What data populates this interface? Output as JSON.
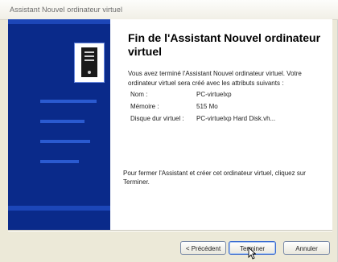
{
  "window": {
    "title": "Assistant Nouvel ordinateur virtuel"
  },
  "main": {
    "heading": "Fin de l'Assistant Nouvel ordinateur virtuel",
    "intro": "Vous avez terminé l'Assistant Nouvel ordinateur virtuel. Votre ordinateur virtuel sera créé avec les attributs suivants :",
    "attributes": [
      {
        "key": "Nom :",
        "value": "PC-virtuelxp"
      },
      {
        "key": "Mémoire :",
        "value": "515 Mo"
      },
      {
        "key": "Disque dur virtuel :",
        "value": "PC-virtuelxp Hard Disk.vh..."
      }
    ],
    "finish_text": "Pour fermer l'Assistant et créer cet ordinateur virtuel, cliquez sur Terminer."
  },
  "buttons": {
    "prev_label": "< Précédent",
    "finish_label": "Terminer",
    "cancel_label": "Annuler"
  },
  "colors": {
    "sidebar": "#0a2a8a",
    "sidebar_band": "#1c46b8"
  },
  "icons": {
    "wizard": "computer-tower-icon",
    "cursor": "mouse-pointer-icon"
  }
}
